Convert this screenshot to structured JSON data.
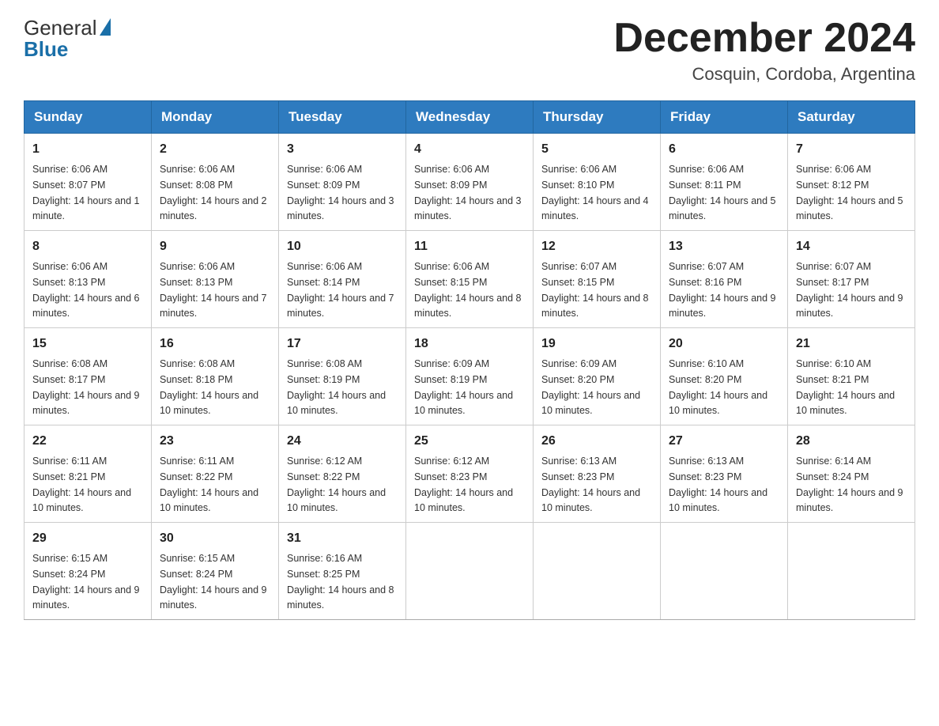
{
  "header": {
    "logo_line1": "General",
    "logo_line2": "Blue",
    "title": "December 2024",
    "subtitle": "Cosquin, Cordoba, Argentina"
  },
  "days_of_week": [
    "Sunday",
    "Monday",
    "Tuesday",
    "Wednesday",
    "Thursday",
    "Friday",
    "Saturday"
  ],
  "weeks": [
    [
      {
        "day": "1",
        "sunrise": "6:06 AM",
        "sunset": "8:07 PM",
        "daylight": "14 hours and 1 minute."
      },
      {
        "day": "2",
        "sunrise": "6:06 AM",
        "sunset": "8:08 PM",
        "daylight": "14 hours and 2 minutes."
      },
      {
        "day": "3",
        "sunrise": "6:06 AM",
        "sunset": "8:09 PM",
        "daylight": "14 hours and 3 minutes."
      },
      {
        "day": "4",
        "sunrise": "6:06 AM",
        "sunset": "8:09 PM",
        "daylight": "14 hours and 3 minutes."
      },
      {
        "day": "5",
        "sunrise": "6:06 AM",
        "sunset": "8:10 PM",
        "daylight": "14 hours and 4 minutes."
      },
      {
        "day": "6",
        "sunrise": "6:06 AM",
        "sunset": "8:11 PM",
        "daylight": "14 hours and 5 minutes."
      },
      {
        "day": "7",
        "sunrise": "6:06 AM",
        "sunset": "8:12 PM",
        "daylight": "14 hours and 5 minutes."
      }
    ],
    [
      {
        "day": "8",
        "sunrise": "6:06 AM",
        "sunset": "8:13 PM",
        "daylight": "14 hours and 6 minutes."
      },
      {
        "day": "9",
        "sunrise": "6:06 AM",
        "sunset": "8:13 PM",
        "daylight": "14 hours and 7 minutes."
      },
      {
        "day": "10",
        "sunrise": "6:06 AM",
        "sunset": "8:14 PM",
        "daylight": "14 hours and 7 minutes."
      },
      {
        "day": "11",
        "sunrise": "6:06 AM",
        "sunset": "8:15 PM",
        "daylight": "14 hours and 8 minutes."
      },
      {
        "day": "12",
        "sunrise": "6:07 AM",
        "sunset": "8:15 PM",
        "daylight": "14 hours and 8 minutes."
      },
      {
        "day": "13",
        "sunrise": "6:07 AM",
        "sunset": "8:16 PM",
        "daylight": "14 hours and 9 minutes."
      },
      {
        "day": "14",
        "sunrise": "6:07 AM",
        "sunset": "8:17 PM",
        "daylight": "14 hours and 9 minutes."
      }
    ],
    [
      {
        "day": "15",
        "sunrise": "6:08 AM",
        "sunset": "8:17 PM",
        "daylight": "14 hours and 9 minutes."
      },
      {
        "day": "16",
        "sunrise": "6:08 AM",
        "sunset": "8:18 PM",
        "daylight": "14 hours and 10 minutes."
      },
      {
        "day": "17",
        "sunrise": "6:08 AM",
        "sunset": "8:19 PM",
        "daylight": "14 hours and 10 minutes."
      },
      {
        "day": "18",
        "sunrise": "6:09 AM",
        "sunset": "8:19 PM",
        "daylight": "14 hours and 10 minutes."
      },
      {
        "day": "19",
        "sunrise": "6:09 AM",
        "sunset": "8:20 PM",
        "daylight": "14 hours and 10 minutes."
      },
      {
        "day": "20",
        "sunrise": "6:10 AM",
        "sunset": "8:20 PM",
        "daylight": "14 hours and 10 minutes."
      },
      {
        "day": "21",
        "sunrise": "6:10 AM",
        "sunset": "8:21 PM",
        "daylight": "14 hours and 10 minutes."
      }
    ],
    [
      {
        "day": "22",
        "sunrise": "6:11 AM",
        "sunset": "8:21 PM",
        "daylight": "14 hours and 10 minutes."
      },
      {
        "day": "23",
        "sunrise": "6:11 AM",
        "sunset": "8:22 PM",
        "daylight": "14 hours and 10 minutes."
      },
      {
        "day": "24",
        "sunrise": "6:12 AM",
        "sunset": "8:22 PM",
        "daylight": "14 hours and 10 minutes."
      },
      {
        "day": "25",
        "sunrise": "6:12 AM",
        "sunset": "8:23 PM",
        "daylight": "14 hours and 10 minutes."
      },
      {
        "day": "26",
        "sunrise": "6:13 AM",
        "sunset": "8:23 PM",
        "daylight": "14 hours and 10 minutes."
      },
      {
        "day": "27",
        "sunrise": "6:13 AM",
        "sunset": "8:23 PM",
        "daylight": "14 hours and 10 minutes."
      },
      {
        "day": "28",
        "sunrise": "6:14 AM",
        "sunset": "8:24 PM",
        "daylight": "14 hours and 9 minutes."
      }
    ],
    [
      {
        "day": "29",
        "sunrise": "6:15 AM",
        "sunset": "8:24 PM",
        "daylight": "14 hours and 9 minutes."
      },
      {
        "day": "30",
        "sunrise": "6:15 AM",
        "sunset": "8:24 PM",
        "daylight": "14 hours and 9 minutes."
      },
      {
        "day": "31",
        "sunrise": "6:16 AM",
        "sunset": "8:25 PM",
        "daylight": "14 hours and 8 minutes."
      },
      null,
      null,
      null,
      null
    ]
  ]
}
